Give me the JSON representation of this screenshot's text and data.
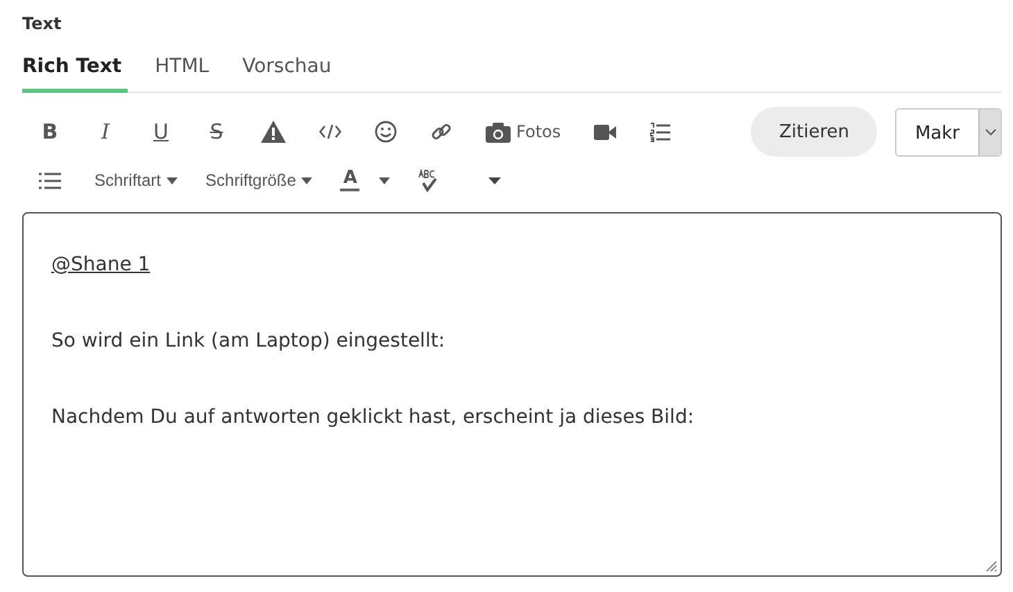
{
  "field_label": "Text",
  "tabs": [
    {
      "label": "Rich Text",
      "selected": true
    },
    {
      "label": "HTML",
      "selected": false
    },
    {
      "label": "Vorschau",
      "selected": false
    }
  ],
  "toolbar_row_1": [
    {
      "kind": "bold",
      "label": "B"
    },
    {
      "kind": "italic",
      "label": "I"
    },
    {
      "kind": "underline",
      "label": "U"
    },
    {
      "kind": "strike",
      "label": "S"
    },
    {
      "kind": "warning"
    },
    {
      "kind": "code"
    },
    {
      "kind": "emoji"
    },
    {
      "kind": "link"
    },
    {
      "kind": "photo",
      "label": "Fotos"
    },
    {
      "kind": "video"
    },
    {
      "kind": "numbered_list"
    }
  ],
  "quote_button": "Zitieren",
  "macro_select": {
    "value": "Makr"
  },
  "toolbar_row_2": [
    {
      "kind": "bullet_list"
    },
    {
      "kind": "dropdown",
      "label": "Schriftart"
    },
    {
      "kind": "dropdown",
      "label": "Schriftgröße"
    },
    {
      "kind": "text_color",
      "label": "A"
    },
    {
      "kind": "spellcheck"
    },
    {
      "kind": "more"
    }
  ],
  "editor": {
    "paragraphs": [
      {
        "kind": "mention",
        "text": "@Shane 1"
      },
      {
        "kind": "text",
        "text": "So wird ein Link (am Laptop) eingestellt:"
      },
      {
        "kind": "text",
        "text": "Nachdem Du auf antworten geklickt hast, erscheint ja dieses Bild:"
      }
    ]
  }
}
